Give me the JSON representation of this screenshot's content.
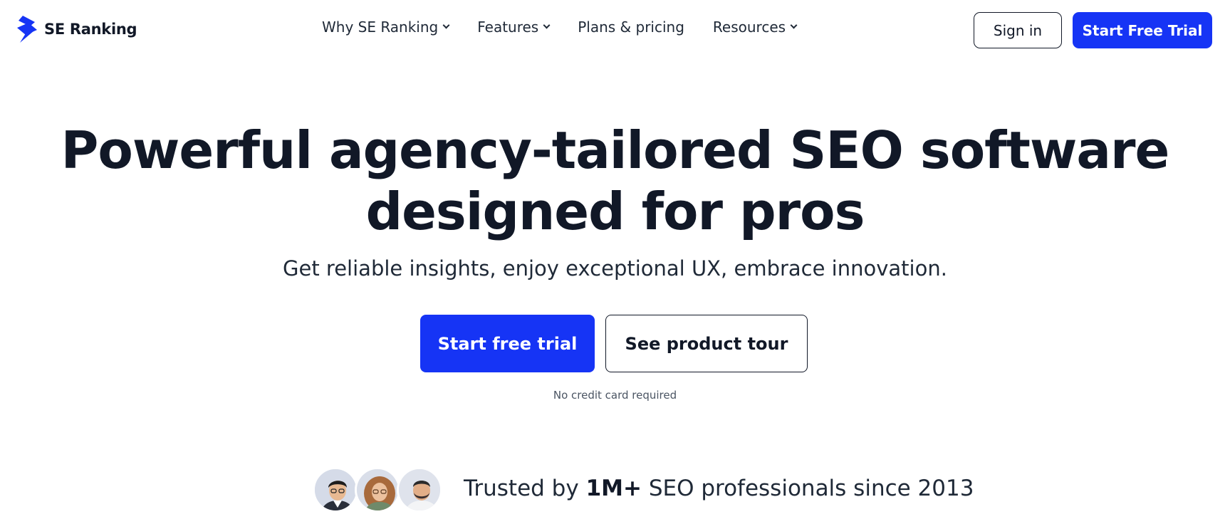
{
  "header": {
    "logo_text": "SE Ranking",
    "logo_icon": "se-ranking-bolt-logo",
    "nav": [
      {
        "label": "Why SE Ranking",
        "has_dropdown": true
      },
      {
        "label": "Features",
        "has_dropdown": true
      },
      {
        "label": "Plans & pricing",
        "has_dropdown": false
      },
      {
        "label": "Resources",
        "has_dropdown": true
      }
    ],
    "sign_in_label": "Sign in",
    "start_trial_label": "Start Free Trial"
  },
  "hero": {
    "title_line1": "Powerful agency-tailored SEO software",
    "title_line2": "designed for pros",
    "subtitle": "Get reliable insights, enjoy exceptional UX, embrace innovation.",
    "primary_cta": "Start free trial",
    "secondary_cta": "See product tour",
    "note": "No credit card required"
  },
  "trust": {
    "prefix": "Trusted by ",
    "highlight": "1M+",
    "suffix": " SEO professionals since 2013",
    "avatars": [
      "avatar-man-glasses",
      "avatar-woman-curly-hair",
      "avatar-man-beard"
    ]
  },
  "colors": {
    "brand_blue": "#1634f5",
    "text_dark": "#111827"
  }
}
